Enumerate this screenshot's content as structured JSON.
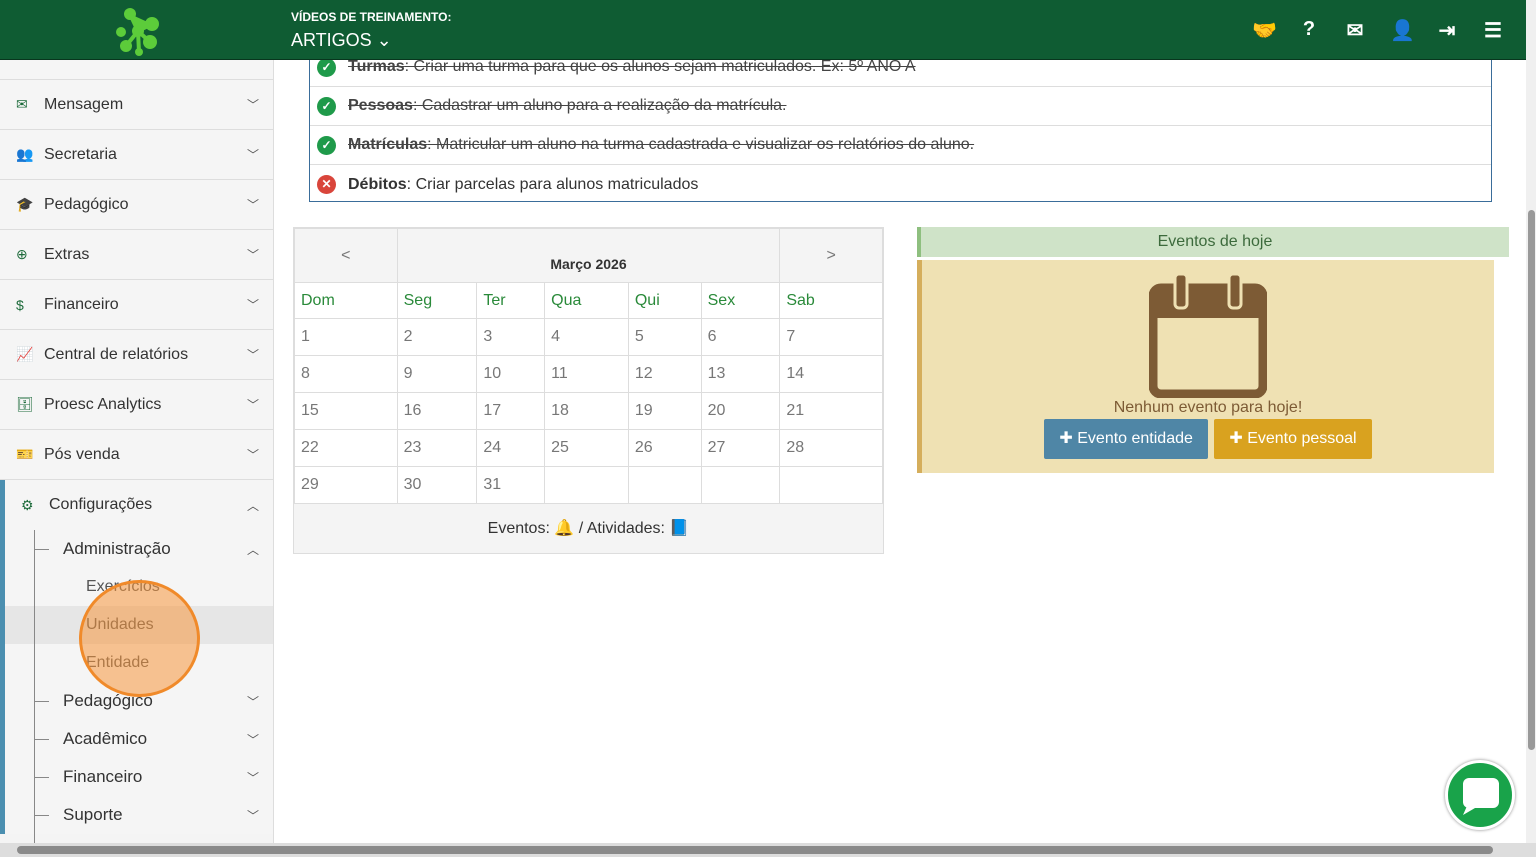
{
  "header": {
    "subtitle": "VÍDEOS DE TREINAMENTO:",
    "selector": "ARTIGOS ⌄",
    "icons": [
      "handshake-icon",
      "question-icon",
      "envelope-icon",
      "user-icon",
      "logout-icon",
      "menu-icon"
    ]
  },
  "sidebar": {
    "items": [
      {
        "label": "Mensagem",
        "icon": "✉"
      },
      {
        "label": "Secretaria",
        "icon": "👥"
      },
      {
        "label": "Pedagógico",
        "icon": "🎓"
      },
      {
        "label": "Extras",
        "icon": "⊕"
      },
      {
        "label": "Financeiro",
        "icon": "$"
      },
      {
        "label": "Central de relatórios",
        "icon": "📈"
      },
      {
        "label": "Proesc Analytics",
        "icon": "🗄"
      },
      {
        "label": "Pós venda",
        "icon": "🎫"
      }
    ],
    "config": "Configurações",
    "admin": "Administração",
    "admin_items": [
      "Exercícios",
      "Unidades",
      "Entidade"
    ],
    "subs": [
      "Pedagógico",
      "Acadêmico",
      "Financeiro",
      "Suporte"
    ]
  },
  "tasks": [
    {
      "title": "Turmas",
      "desc": ": Criar uma turma para que os alunos sejam matriculados. Ex: 5º ANO A",
      "done": true
    },
    {
      "title": "Pessoas",
      "desc": ": Cadastrar um aluno para a realização da matrícula.",
      "done": true
    },
    {
      "title": "Matrículas",
      "desc": ": Matricular um aluno na turma cadastrada e visualizar os relatórios do aluno.",
      "done": true
    },
    {
      "title": "Débitos",
      "desc": ": Criar parcelas para alunos matriculados",
      "done": false
    }
  ],
  "calendar": {
    "prev": "<",
    "next": ">",
    "month": "Março 2026",
    "days": [
      "Dom",
      "Seg",
      "Ter",
      "Qua",
      "Qui",
      "Sex",
      "Sab"
    ],
    "weeks": [
      [
        "1",
        "2",
        "3",
        "4",
        "5",
        "6",
        "7"
      ],
      [
        "8",
        "9",
        "10",
        "11",
        "12",
        "13",
        "14"
      ],
      [
        "15",
        "16",
        "17",
        "18",
        "19",
        "20",
        "21"
      ],
      [
        "22",
        "23",
        "24",
        "25",
        "26",
        "27",
        "28"
      ],
      [
        "29",
        "30",
        "31",
        "",
        "",
        "",
        ""
      ]
    ],
    "footer": "Eventos: 🔔 / Atividades: 📘"
  },
  "events": {
    "title": "Eventos de hoje",
    "empty": "Nenhum evento para hoje!",
    "btn_entity": "✚ Evento entidade",
    "btn_personal": "✚ Evento pessoal"
  }
}
